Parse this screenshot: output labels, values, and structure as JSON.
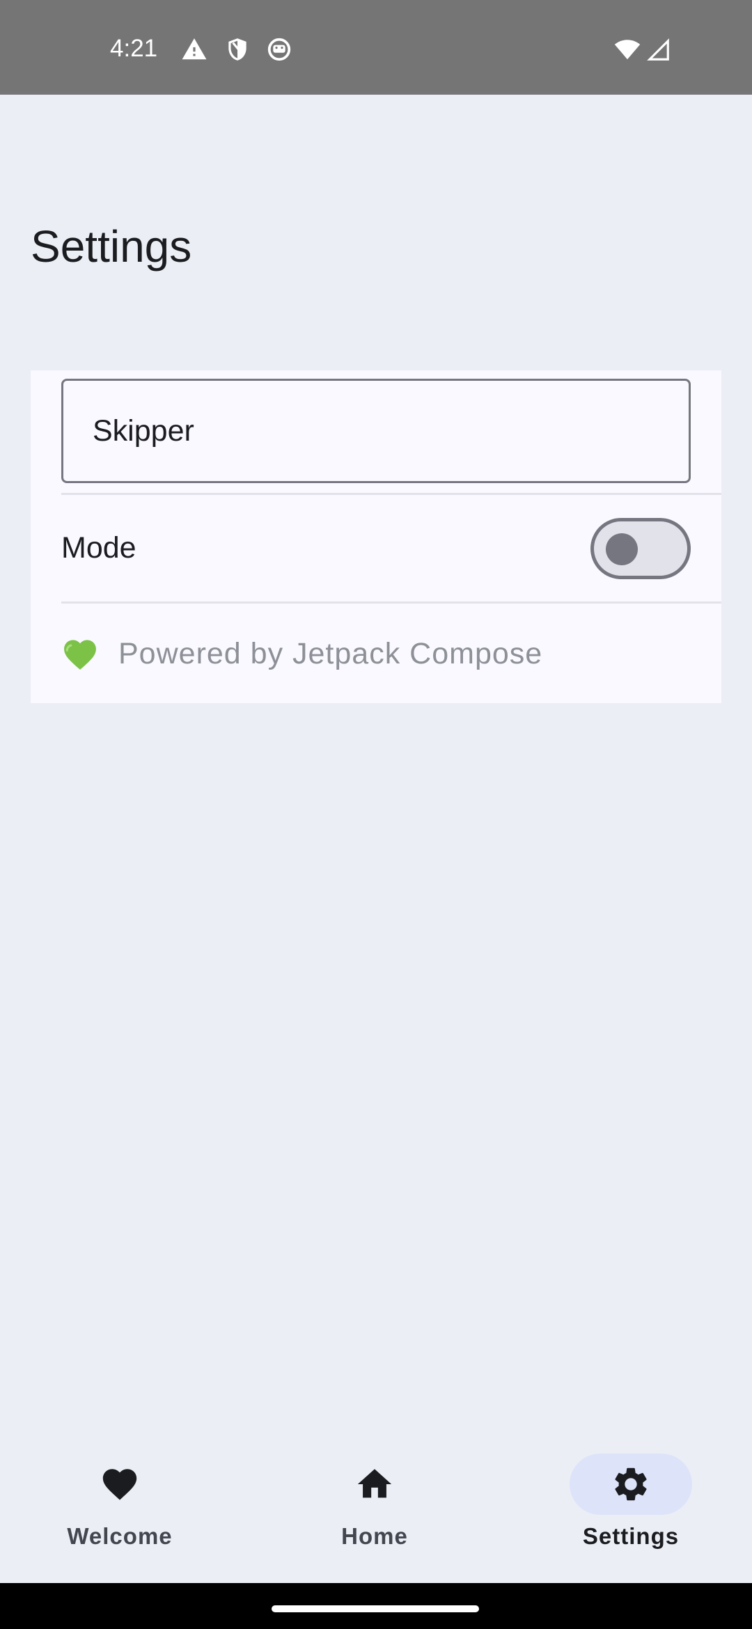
{
  "status_bar": {
    "time": "4:21",
    "left_icons": [
      "warning-icon",
      "shield-icon",
      "face-icon"
    ],
    "right_icons": [
      "wifi-icon",
      "signal-icon"
    ]
  },
  "page": {
    "title": "Settings"
  },
  "settings": {
    "name_field": {
      "value": "Skipper",
      "placeholder": ""
    },
    "mode": {
      "label": "Mode",
      "enabled": false
    },
    "footer": {
      "icon": "green-heart-icon",
      "text": "Powered by Jetpack Compose"
    }
  },
  "bottom_nav": {
    "items": [
      {
        "label": "Welcome",
        "icon": "heart-icon",
        "active": false
      },
      {
        "label": "Home",
        "icon": "home-icon",
        "active": false
      },
      {
        "label": "Settings",
        "icon": "settings-icon",
        "active": true
      }
    ]
  },
  "colors": {
    "background": "#eceef6",
    "card": "#f9f9ff",
    "outline": "#767680",
    "active_indicator": "#dde3f9",
    "footer_text": "#8e9098",
    "heart_green": "#7cc247"
  }
}
